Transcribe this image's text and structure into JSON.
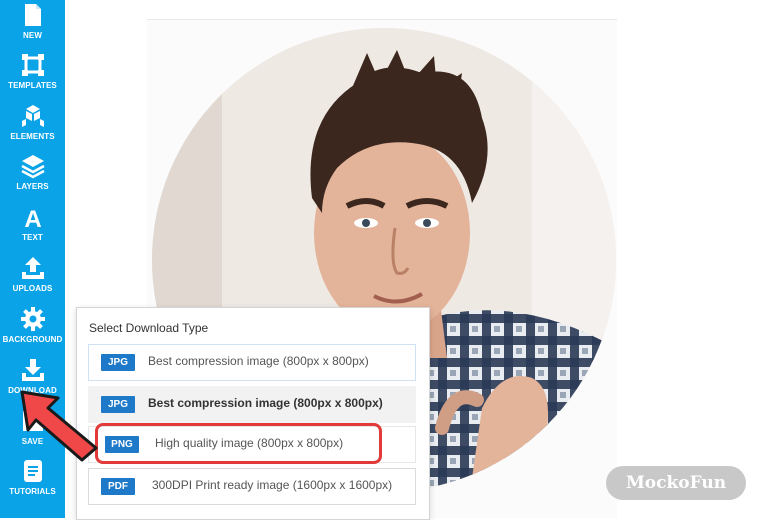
{
  "sidebar": {
    "items": [
      {
        "label": "NEW",
        "icon": "new-file-icon"
      },
      {
        "label": "TEMPLATES",
        "icon": "templates-icon"
      },
      {
        "label": "ELEMENTS",
        "icon": "elements-icon"
      },
      {
        "label": "LAYERS",
        "icon": "layers-icon"
      },
      {
        "label": "TEXT",
        "icon": "text-icon"
      },
      {
        "label": "UPLOADS",
        "icon": "upload-icon"
      },
      {
        "label": "BACKGROUND",
        "icon": "gear-icon"
      },
      {
        "label": "DOWNLOAD",
        "icon": "download-icon"
      },
      {
        "label": "SAVE",
        "icon": "save-icon"
      },
      {
        "label": "TUTORIALS",
        "icon": "tutorials-icon"
      }
    ]
  },
  "download_menu": {
    "title": "Select Download Type",
    "options": [
      {
        "type": "JPG",
        "label": "Best compression image (800px x 800px)"
      },
      {
        "type": "JPG",
        "label": "Best compression image (800px x 800px)"
      },
      {
        "type": "PNG",
        "label": "High quality image (800px x 800px)"
      },
      {
        "type": "PDF",
        "label": "300DPI Print ready image (1600px x 1600px)"
      }
    ]
  },
  "watermark": "MockoFun",
  "colors": {
    "sidebar": "#0aa3e8",
    "tag": "#1e79c9",
    "highlight": "#e23a3a",
    "arrow": "#f04848"
  }
}
